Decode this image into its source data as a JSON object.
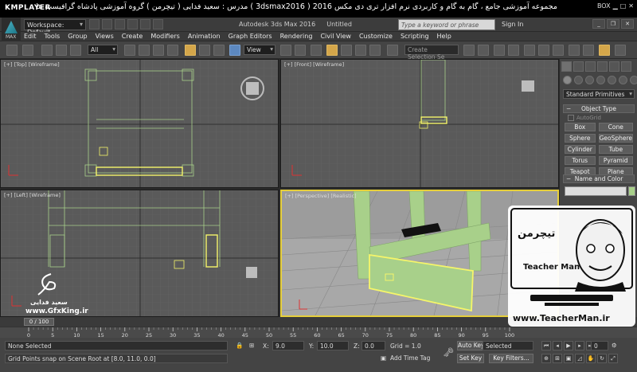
{
  "player": {
    "brand": "KMPLAYER",
    "title": "مجموعه آموزشی جامع ، گام به گام و کاربردی نرم افزار تری دی مکس 2016  ( 3dsmax2016 )  مدرس : سعید فدایی ( تیچرمن ) گروه آموزشی پادشاه گرافیست ها",
    "box_label": "BOX"
  },
  "app": {
    "logo_label": "MAX",
    "workspace": "Workspace: Default",
    "title": "Autodesk 3ds Max 2016",
    "document": "Untitled",
    "search_placeholder": "Type a keyword or phrase",
    "sign_in": "Sign In"
  },
  "menu": [
    "Edit",
    "Tools",
    "Group",
    "Views",
    "Create",
    "Modifiers",
    "Animation",
    "Graph Editors",
    "Rendering",
    "Civil View",
    "Customize",
    "Scripting",
    "Help"
  ],
  "toolbar": {
    "filter": "All",
    "ref_coord": "View",
    "named_selection": "Create Selection Se"
  },
  "viewports": [
    {
      "label": "[+] [Top] [Wireframe]",
      "active": false
    },
    {
      "label": "[+] [Front] [Wireframe]",
      "active": false
    },
    {
      "label": "[+] [Left] [Wireframe]",
      "active": false
    },
    {
      "label": "[+] [Perspective] [Realistic]",
      "active": true
    }
  ],
  "command_panel": {
    "category": "Standard Primitives",
    "object_type_title": "Object Type",
    "autogrid": "AutoGrid",
    "primitives": [
      "Box",
      "Cone",
      "Sphere",
      "GeoSphere",
      "Cylinder",
      "Tube",
      "Torus",
      "Pyramid",
      "Teapot",
      "Plane"
    ],
    "name_color_title": "Name and Color"
  },
  "timeline": {
    "frame_display": "0 / 100",
    "ticks": [
      "0",
      "5",
      "10",
      "15",
      "20",
      "25",
      "30",
      "35",
      "40",
      "45",
      "50",
      "55",
      "60",
      "65",
      "70",
      "75",
      "80",
      "85",
      "90",
      "95",
      "100"
    ]
  },
  "status": {
    "selection": "None Selected",
    "prompt": "Grid Points snap on Scene Root at [8.0, 11.0, 0.0]",
    "x_label": "X:",
    "x_value": "9.0",
    "y_label": "Y:",
    "y_value": "10.0",
    "z_label": "Z:",
    "z_value": "0.0",
    "grid": "Grid = 1.0",
    "add_time_tag": "Add Time Tag",
    "auto_key": "Auto Key",
    "key_mode": "Selected",
    "set_key": "Set Key",
    "key_filters": "Key Filters...",
    "frame_field": "0"
  },
  "overlay": {
    "teacher_fa": "تیچرمن",
    "teacher_en": "Teacher Man",
    "website": "www.TeacherMan.ir",
    "watermark_name": "سعید فدایی",
    "watermark_url": "www.GfxKing.ir"
  },
  "colors": {
    "viewport_bg": "#5a5a5a",
    "perspective_bg": "#9a9a9a",
    "object_green": "#a8d08a",
    "selection_yellow": "#f5f56a",
    "active_border": "#e6cf3b"
  }
}
